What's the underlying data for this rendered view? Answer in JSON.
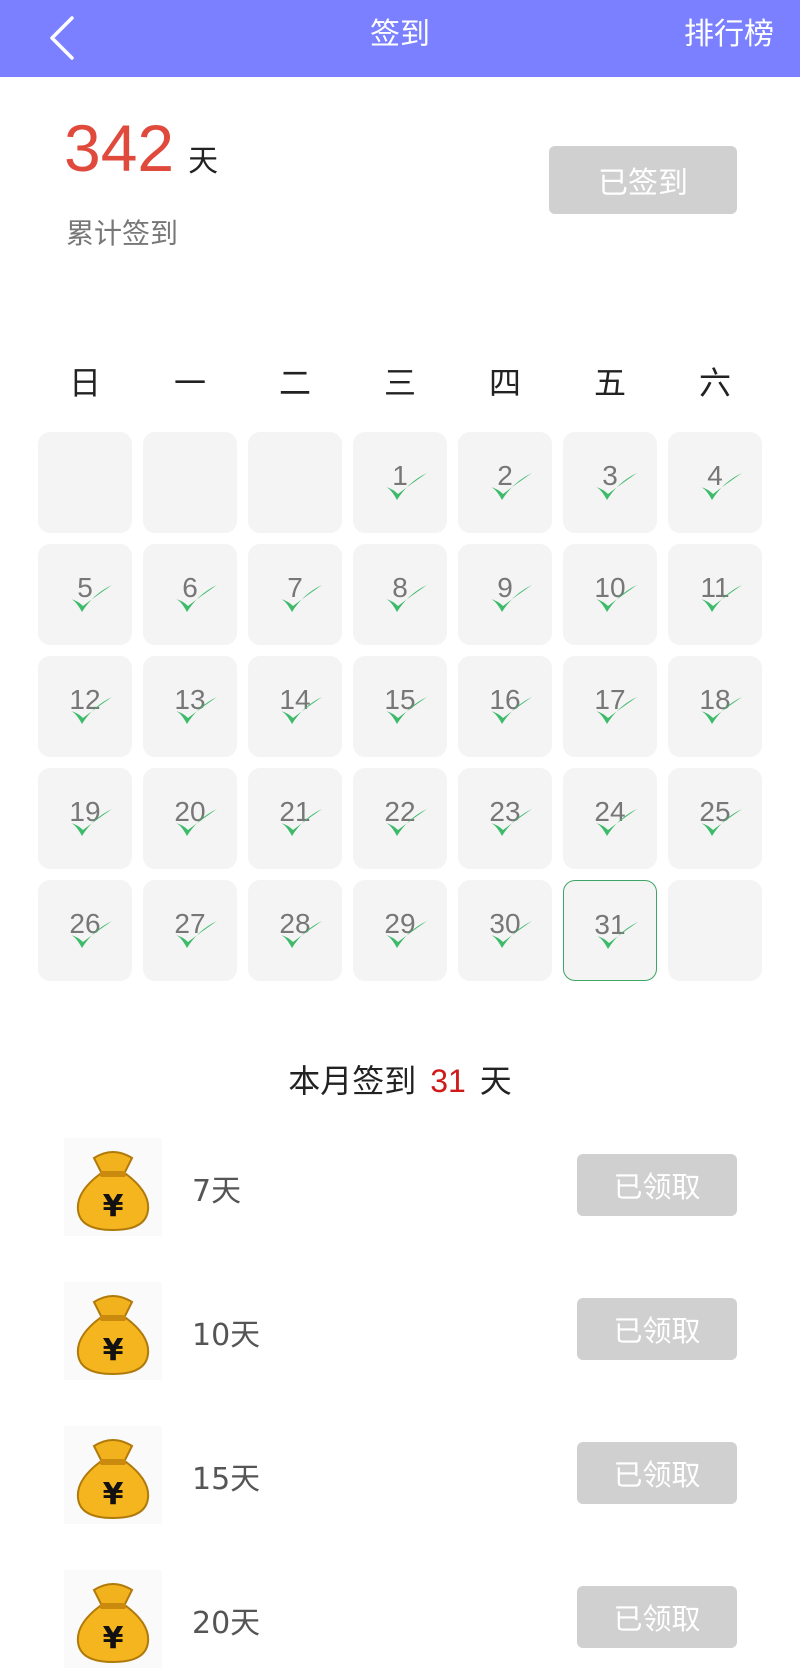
{
  "header": {
    "title": "签到",
    "ranking_label": "排行榜",
    "background_color": "#7a80ff"
  },
  "summary": {
    "total_days": "342",
    "total_unit": "天",
    "total_label": "累计签到",
    "sign_button_label": "已签到"
  },
  "calendar": {
    "weekdays": [
      "日",
      "一",
      "二",
      "三",
      "四",
      "五",
      "六"
    ],
    "first_weekday_index": 3,
    "days_in_month": 31,
    "today": 31,
    "signed_days": [
      1,
      2,
      3,
      4,
      5,
      6,
      7,
      8,
      9,
      10,
      11,
      12,
      13,
      14,
      15,
      16,
      17,
      18,
      19,
      20,
      21,
      22,
      23,
      24,
      25,
      26,
      27,
      28,
      29,
      30,
      31
    ],
    "check_color": "#3dba6a"
  },
  "month_summary": {
    "prefix": "本月签到",
    "count": "31",
    "suffix": "天"
  },
  "rewards": [
    {
      "label": "7天",
      "button_label": "已领取",
      "icon": "money-bag-icon"
    },
    {
      "label": "10天",
      "button_label": "已领取",
      "icon": "money-bag-icon"
    },
    {
      "label": "15天",
      "button_label": "已领取",
      "icon": "money-bag-icon"
    },
    {
      "label": "20天",
      "button_label": "已领取",
      "icon": "money-bag-icon"
    }
  ]
}
